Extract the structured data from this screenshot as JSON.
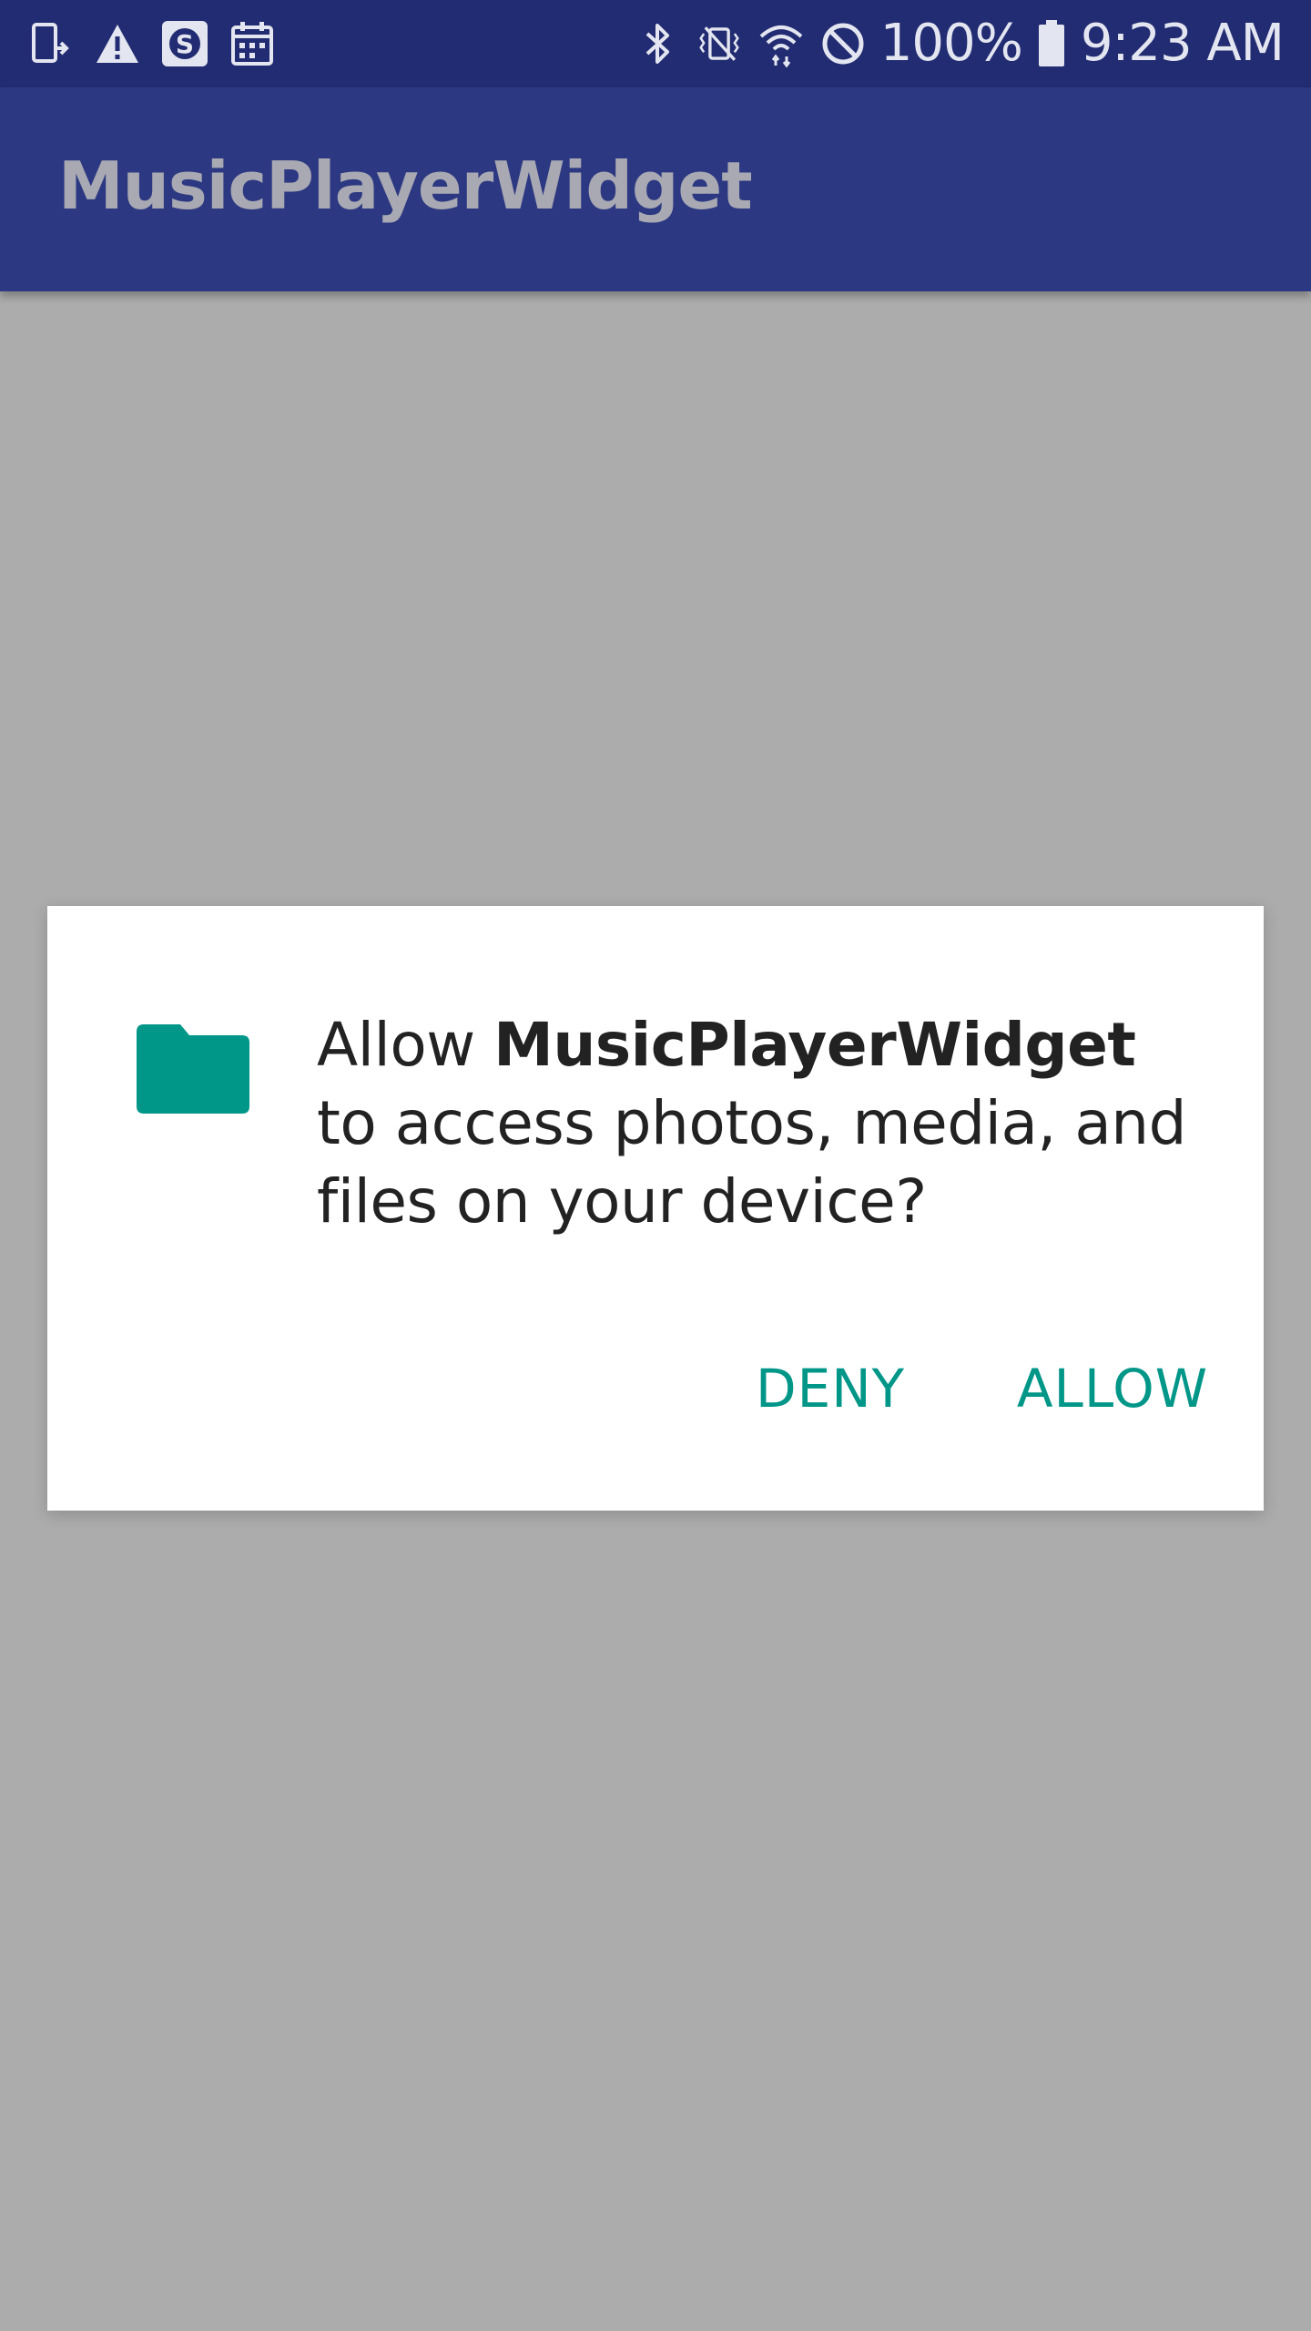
{
  "status_bar": {
    "left_icons": [
      "phone-sync-icon",
      "warning-icon",
      "skype-icon",
      "calendar-icon"
    ],
    "right_icons": [
      "bluetooth-icon",
      "vibrate-mute-icon",
      "wifi-icon",
      "do-not-disturb-icon",
      "battery-icon"
    ],
    "battery_percent": "100%",
    "time": "9:23 AM"
  },
  "app_bar": {
    "title": "MusicPlayerWidget"
  },
  "dialog": {
    "icon": "folder-icon",
    "message_prefix": "Allow ",
    "app_name": "MusicPlayerWidget",
    "message_suffix": " to access photos, media, and files on your device?",
    "deny_label": "DENY",
    "allow_label": "ALLOW"
  },
  "colors": {
    "status_bar": "#222c72",
    "app_bar": "#2c3882",
    "scrim_background": "#acacac",
    "accent": "#009688",
    "dialog_background": "#ffffff"
  }
}
